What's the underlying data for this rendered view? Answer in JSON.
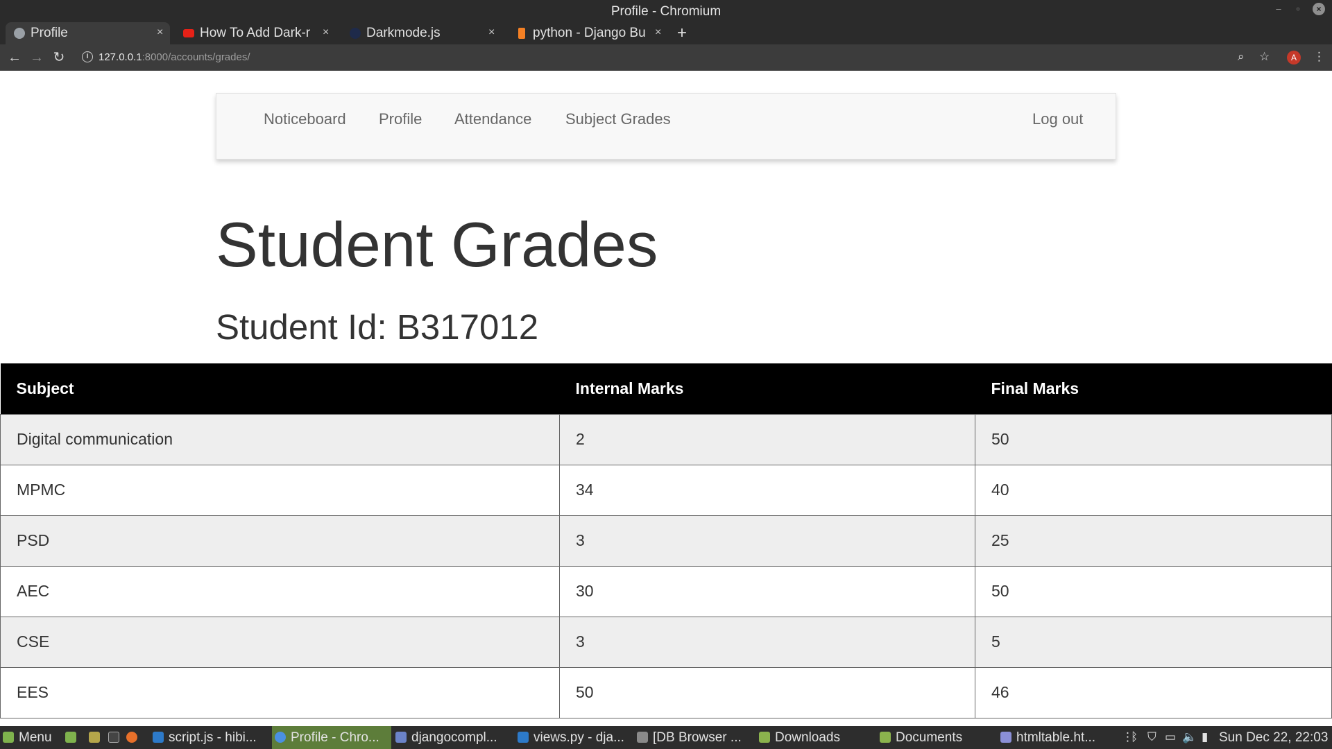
{
  "window": {
    "title": "Profile - Chromium"
  },
  "tabs": [
    {
      "title": "Profile",
      "icon": "globe-icon",
      "active": true
    },
    {
      "title": "How To Add Dark-r",
      "icon": "youtube-icon"
    },
    {
      "title": "Darkmode.js",
      "icon": "dark-circle-icon"
    },
    {
      "title": "python - Django Bu",
      "icon": "stackoverflow-icon"
    }
  ],
  "toolbar": {
    "url_host": "127.0.0.1",
    "url_rest": ":8000/accounts/grades/",
    "avatar_letter": "A"
  },
  "navbar": {
    "links": [
      "Noticeboard",
      "Profile",
      "Attendance",
      "Subject Grades"
    ],
    "logout": "Log out"
  },
  "page": {
    "title": "Student Grades",
    "student_id": "Student Id: B317012"
  },
  "table": {
    "headers": [
      "Subject",
      "Internal Marks",
      "Final Marks"
    ],
    "rows": [
      [
        "Digital communication",
        "2",
        "50"
      ],
      [
        "MPMC",
        "34",
        "40"
      ],
      [
        "PSD",
        "3",
        "25"
      ],
      [
        "AEC",
        "30",
        "50"
      ],
      [
        "CSE",
        "3",
        "5"
      ],
      [
        "EES",
        "50",
        "46"
      ]
    ]
  },
  "taskbar": {
    "menu": "Menu",
    "items": [
      {
        "label": "script.js - hibi...",
        "icon": "vscode-icon",
        "active": false
      },
      {
        "label": "Profile - Chro...",
        "icon": "chromium-icon",
        "active": true
      },
      {
        "label": "djangocompl...",
        "icon": "document-icon",
        "active": false
      },
      {
        "label": "views.py - dja...",
        "icon": "vscode-icon",
        "active": false
      },
      {
        "label": "[DB Browser ...",
        "icon": "database-icon",
        "active": false
      },
      {
        "label": "Downloads",
        "icon": "folder-icon",
        "active": false
      },
      {
        "label": "Documents",
        "icon": "folder-icon",
        "active": false
      },
      {
        "label": "htmltable.ht...",
        "icon": "document-icon",
        "active": false
      }
    ],
    "clock": "Sun Dec 22, 22:03"
  },
  "colors": {
    "table_header_bg": "#000000",
    "row_odd_bg": "#eeeeee",
    "row_even_bg": "#ffffff",
    "taskbar_active": "#5d7d3a"
  }
}
